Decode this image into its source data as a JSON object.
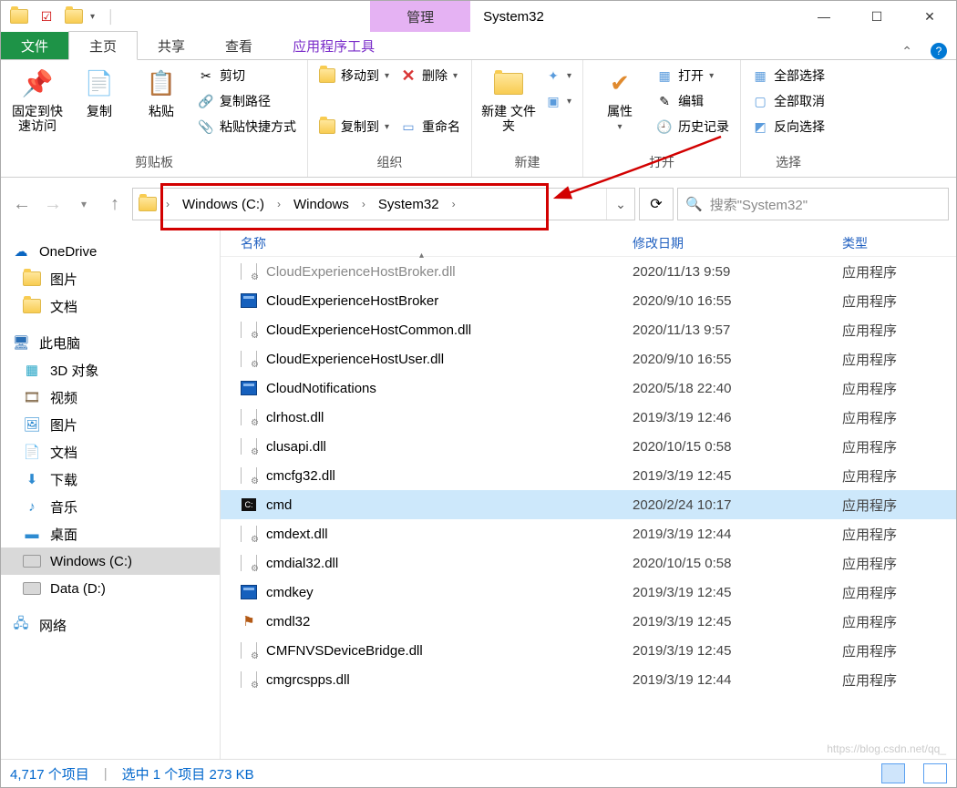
{
  "titlebar": {
    "manage": "管理",
    "title": "System32"
  },
  "tabs": {
    "file": "文件",
    "home": "主页",
    "share": "共享",
    "view": "查看",
    "apptools": "应用程序工具"
  },
  "ribbon": {
    "clipboard": {
      "label": "剪贴板",
      "pin": "固定到快\n速访问",
      "copy": "复制",
      "paste": "粘贴",
      "cut": "剪切",
      "copy_path": "复制路径",
      "paste_shortcut": "粘贴快捷方式"
    },
    "organize": {
      "label": "组织",
      "move_to": "移动到",
      "copy_to": "复制到",
      "delete": "删除",
      "rename": "重命名"
    },
    "new": {
      "label": "新建",
      "new_folder": "新建\n文件夹"
    },
    "open": {
      "label": "打开",
      "properties": "属性",
      "open": "打开",
      "edit": "编辑",
      "history": "历史记录"
    },
    "select": {
      "label": "选择",
      "select_all": "全部选择",
      "select_none": "全部取消",
      "invert": "反向选择"
    }
  },
  "breadcrumb": [
    "Windows (C:)",
    "Windows",
    "System32"
  ],
  "search": {
    "placeholder": "搜索\"System32\""
  },
  "sidebar": {
    "onedrive": "OneDrive",
    "pictures": "图片",
    "documents": "文档",
    "this_pc": "此电脑",
    "objects3d": "3D 对象",
    "videos": "视频",
    "pictures2": "图片",
    "documents2": "文档",
    "downloads": "下载",
    "music": "音乐",
    "desktop": "桌面",
    "drive_c": "Windows (C:)",
    "drive_d": "Data (D:)",
    "network": "网络"
  },
  "columns": {
    "name": "名称",
    "date": "修改日期",
    "type": "类型"
  },
  "files": [
    {
      "icon": "dll",
      "name": "CloudExperienceHostBroker.dll",
      "date": "2020/11/13 9:59",
      "type": "应用程序",
      "cut": true
    },
    {
      "icon": "exe",
      "name": "CloudExperienceHostBroker",
      "date": "2020/9/10 16:55",
      "type": "应用程序"
    },
    {
      "icon": "dll",
      "name": "CloudExperienceHostCommon.dll",
      "date": "2020/11/13 9:57",
      "type": "应用程序"
    },
    {
      "icon": "dll",
      "name": "CloudExperienceHostUser.dll",
      "date": "2020/9/10 16:55",
      "type": "应用程序"
    },
    {
      "icon": "exe",
      "name": "CloudNotifications",
      "date": "2020/5/18 22:40",
      "type": "应用程序"
    },
    {
      "icon": "dll",
      "name": "clrhost.dll",
      "date": "2019/3/19 12:46",
      "type": "应用程序"
    },
    {
      "icon": "dll",
      "name": "clusapi.dll",
      "date": "2020/10/15 0:58",
      "type": "应用程序"
    },
    {
      "icon": "dll",
      "name": "cmcfg32.dll",
      "date": "2019/3/19 12:45",
      "type": "应用程序"
    },
    {
      "icon": "cmd",
      "name": "cmd",
      "date": "2020/2/24 10:17",
      "type": "应用程序",
      "selected": true
    },
    {
      "icon": "dll",
      "name": "cmdext.dll",
      "date": "2019/3/19 12:44",
      "type": "应用程序"
    },
    {
      "icon": "dll",
      "name": "cmdial32.dll",
      "date": "2020/10/15 0:58",
      "type": "应用程序"
    },
    {
      "icon": "exe",
      "name": "cmdkey",
      "date": "2019/3/19 12:45",
      "type": "应用程序"
    },
    {
      "icon": "exe2",
      "name": "cmdl32",
      "date": "2019/3/19 12:45",
      "type": "应用程序"
    },
    {
      "icon": "dll",
      "name": "CMFNVSDeviceBridge.dll",
      "date": "2019/3/19 12:45",
      "type": "应用程序"
    },
    {
      "icon": "dll",
      "name": "cmgrcspps.dll",
      "date": "2019/3/19 12:44",
      "type": "应用程序"
    }
  ],
  "status": {
    "items": "4,717 个项目",
    "selected": "选中 1 个项目  273 KB"
  },
  "watermark": "https://blog.csdn.net/qq_"
}
